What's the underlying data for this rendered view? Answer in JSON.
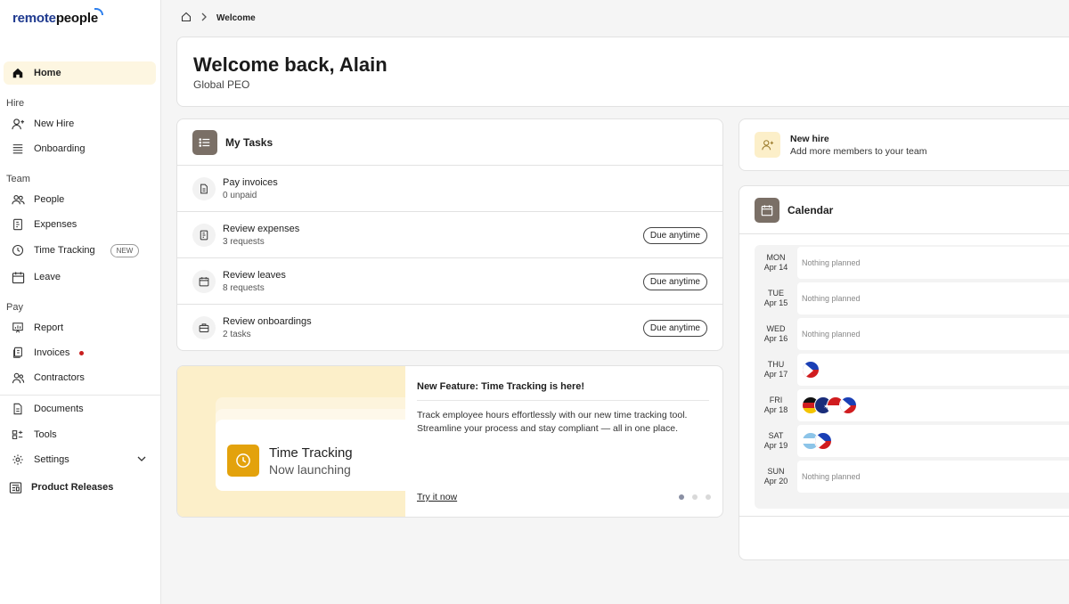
{
  "app": {
    "logo_part1": "remote",
    "logo_part2": "people"
  },
  "sidebar": {
    "home": "Home",
    "section_hire": "Hire",
    "new_hire": "New Hire",
    "onboarding": "Onboarding",
    "section_team": "Team",
    "people": "People",
    "expenses": "Expenses",
    "time_tracking": "Time Tracking",
    "time_tracking_badge": "NEW",
    "leave": "Leave",
    "section_pay": "Pay",
    "report": "Report",
    "invoices": "Invoices",
    "contractors": "Contractors",
    "documents": "Documents",
    "tools": "Tools",
    "settings": "Settings",
    "product_releases": "Product Releases"
  },
  "breadcrumb": {
    "current": "Welcome"
  },
  "welcome": {
    "title": "Welcome back, Alain",
    "subtitle": "Global PEO"
  },
  "tasks": {
    "title": "My Tasks",
    "items": [
      {
        "title": "Pay invoices",
        "sub": "0 unpaid",
        "due": ""
      },
      {
        "title": "Review expenses",
        "sub": "3 requests",
        "due": "Due anytime"
      },
      {
        "title": "Review leaves",
        "sub": "8 requests",
        "due": "Due anytime"
      },
      {
        "title": "Review onboardings",
        "sub": "2 tasks",
        "due": "Due anytime"
      }
    ]
  },
  "feature": {
    "card_title": "Time Tracking",
    "card_sub": "Now launching",
    "title": "New Feature: Time Tracking is here!",
    "text": "Track employee hours effortlessly with our new time tracking tool. Streamline your process and stay compliant — all in one place.",
    "link": "Try it now"
  },
  "new_hire_card": {
    "title": "New hire",
    "sub": "Add more members to your team"
  },
  "calendar": {
    "title": "Calendar",
    "days": [
      {
        "day": "MON",
        "date": "Apr 14",
        "text": "Nothing planned"
      },
      {
        "day": "TUE",
        "date": "Apr 15",
        "text": "Nothing planned"
      },
      {
        "day": "WED",
        "date": "Apr 16",
        "text": "Nothing planned"
      },
      {
        "day": "THU",
        "date": "Apr 17",
        "text": ""
      },
      {
        "day": "FRI",
        "date": "Apr 18",
        "text": ""
      },
      {
        "day": "SAT",
        "date": "Apr 19",
        "text": ""
      },
      {
        "day": "SUN",
        "date": "Apr 20",
        "text": "Nothing planned"
      }
    ]
  },
  "colors": {
    "active_nav_bg": "#fdf6e1",
    "accent_yellow": "#e3a20c",
    "header_icon_bg": "#7a6f66",
    "logo_blue": "#1f3a8f",
    "notification_dot": "#c81e1e"
  }
}
